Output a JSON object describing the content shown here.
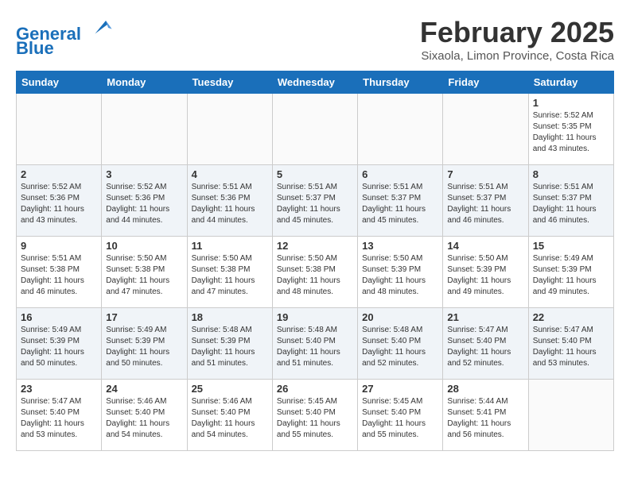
{
  "logo": {
    "line1": "General",
    "line2": "Blue"
  },
  "title": "February 2025",
  "subtitle": "Sixaola, Limon Province, Costa Rica",
  "days_of_week": [
    "Sunday",
    "Monday",
    "Tuesday",
    "Wednesday",
    "Thursday",
    "Friday",
    "Saturday"
  ],
  "weeks": [
    [
      {
        "day": "",
        "info": ""
      },
      {
        "day": "",
        "info": ""
      },
      {
        "day": "",
        "info": ""
      },
      {
        "day": "",
        "info": ""
      },
      {
        "day": "",
        "info": ""
      },
      {
        "day": "",
        "info": ""
      },
      {
        "day": "1",
        "info": "Sunrise: 5:52 AM\nSunset: 5:35 PM\nDaylight: 11 hours\nand 43 minutes."
      }
    ],
    [
      {
        "day": "2",
        "info": "Sunrise: 5:52 AM\nSunset: 5:36 PM\nDaylight: 11 hours\nand 43 minutes."
      },
      {
        "day": "3",
        "info": "Sunrise: 5:52 AM\nSunset: 5:36 PM\nDaylight: 11 hours\nand 44 minutes."
      },
      {
        "day": "4",
        "info": "Sunrise: 5:51 AM\nSunset: 5:36 PM\nDaylight: 11 hours\nand 44 minutes."
      },
      {
        "day": "5",
        "info": "Sunrise: 5:51 AM\nSunset: 5:37 PM\nDaylight: 11 hours\nand 45 minutes."
      },
      {
        "day": "6",
        "info": "Sunrise: 5:51 AM\nSunset: 5:37 PM\nDaylight: 11 hours\nand 45 minutes."
      },
      {
        "day": "7",
        "info": "Sunrise: 5:51 AM\nSunset: 5:37 PM\nDaylight: 11 hours\nand 46 minutes."
      },
      {
        "day": "8",
        "info": "Sunrise: 5:51 AM\nSunset: 5:37 PM\nDaylight: 11 hours\nand 46 minutes."
      }
    ],
    [
      {
        "day": "9",
        "info": "Sunrise: 5:51 AM\nSunset: 5:38 PM\nDaylight: 11 hours\nand 46 minutes."
      },
      {
        "day": "10",
        "info": "Sunrise: 5:50 AM\nSunset: 5:38 PM\nDaylight: 11 hours\nand 47 minutes."
      },
      {
        "day": "11",
        "info": "Sunrise: 5:50 AM\nSunset: 5:38 PM\nDaylight: 11 hours\nand 47 minutes."
      },
      {
        "day": "12",
        "info": "Sunrise: 5:50 AM\nSunset: 5:38 PM\nDaylight: 11 hours\nand 48 minutes."
      },
      {
        "day": "13",
        "info": "Sunrise: 5:50 AM\nSunset: 5:39 PM\nDaylight: 11 hours\nand 48 minutes."
      },
      {
        "day": "14",
        "info": "Sunrise: 5:50 AM\nSunset: 5:39 PM\nDaylight: 11 hours\nand 49 minutes."
      },
      {
        "day": "15",
        "info": "Sunrise: 5:49 AM\nSunset: 5:39 PM\nDaylight: 11 hours\nand 49 minutes."
      }
    ],
    [
      {
        "day": "16",
        "info": "Sunrise: 5:49 AM\nSunset: 5:39 PM\nDaylight: 11 hours\nand 50 minutes."
      },
      {
        "day": "17",
        "info": "Sunrise: 5:49 AM\nSunset: 5:39 PM\nDaylight: 11 hours\nand 50 minutes."
      },
      {
        "day": "18",
        "info": "Sunrise: 5:48 AM\nSunset: 5:39 PM\nDaylight: 11 hours\nand 51 minutes."
      },
      {
        "day": "19",
        "info": "Sunrise: 5:48 AM\nSunset: 5:40 PM\nDaylight: 11 hours\nand 51 minutes."
      },
      {
        "day": "20",
        "info": "Sunrise: 5:48 AM\nSunset: 5:40 PM\nDaylight: 11 hours\nand 52 minutes."
      },
      {
        "day": "21",
        "info": "Sunrise: 5:47 AM\nSunset: 5:40 PM\nDaylight: 11 hours\nand 52 minutes."
      },
      {
        "day": "22",
        "info": "Sunrise: 5:47 AM\nSunset: 5:40 PM\nDaylight: 11 hours\nand 53 minutes."
      }
    ],
    [
      {
        "day": "23",
        "info": "Sunrise: 5:47 AM\nSunset: 5:40 PM\nDaylight: 11 hours\nand 53 minutes."
      },
      {
        "day": "24",
        "info": "Sunrise: 5:46 AM\nSunset: 5:40 PM\nDaylight: 11 hours\nand 54 minutes."
      },
      {
        "day": "25",
        "info": "Sunrise: 5:46 AM\nSunset: 5:40 PM\nDaylight: 11 hours\nand 54 minutes."
      },
      {
        "day": "26",
        "info": "Sunrise: 5:45 AM\nSunset: 5:40 PM\nDaylight: 11 hours\nand 55 minutes."
      },
      {
        "day": "27",
        "info": "Sunrise: 5:45 AM\nSunset: 5:40 PM\nDaylight: 11 hours\nand 55 minutes."
      },
      {
        "day": "28",
        "info": "Sunrise: 5:44 AM\nSunset: 5:41 PM\nDaylight: 11 hours\nand 56 minutes."
      },
      {
        "day": "",
        "info": ""
      }
    ]
  ]
}
